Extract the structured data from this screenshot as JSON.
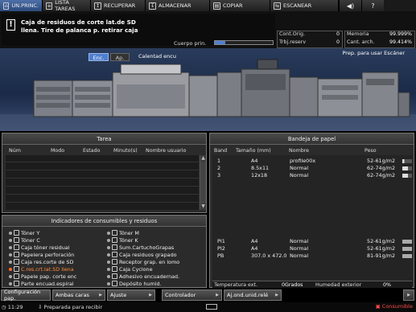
{
  "topbar": {
    "tabs": [
      {
        "label": "UN.PRINC.",
        "icon": "home-icon",
        "active": true
      },
      {
        "label": "LISTA TAREAS",
        "icon": "job-list-icon",
        "active": false
      },
      {
        "label": "RECUPERAR",
        "icon": "recall-icon",
        "active": false
      },
      {
        "label": "ALMACENAR",
        "icon": "store-icon",
        "active": false
      },
      {
        "label": "COPIAR",
        "icon": "copy-icon",
        "active": false
      },
      {
        "label": "ESCANEAR",
        "icon": "scan-icon",
        "active": false
      }
    ],
    "volume_icon": "speaker-icon",
    "help_icon": "?"
  },
  "message": {
    "icon": "!",
    "line1": "Caja de residuos de corte lat.de SD",
    "line2": "llena. Tire de palanca p. retirar caja"
  },
  "toner_bar": {
    "label": "Cuerpo prin.",
    "level": 0.18
  },
  "counters": {
    "orig_label": "Cont.Orig.",
    "orig_value": "0",
    "memory_label": "Memoria",
    "memory_value": "99.999%",
    "reserve_label": "Trbj.reserv",
    "reserve_value": "0",
    "arch_label": "Cant. arch.",
    "arch_value": "99.414%"
  },
  "machine": {
    "enc_label": "Enc.",
    "ap_label": "Ap.",
    "warm_label": "Calentad encu",
    "scan_label": "Prep. para usar Escáner"
  },
  "tasks": {
    "title": "Tarea",
    "columns": [
      "Núm",
      "Modo",
      "Estado",
      "Minuto(s)",
      "Nombre usuario"
    ]
  },
  "consumables": {
    "title": "Indicadores de consumibles y residuos",
    "items": [
      {
        "label": "Tóner Y",
        "warn": false
      },
      {
        "label": "Tóner M",
        "warn": false
      },
      {
        "label": "Tóner C",
        "warn": false
      },
      {
        "label": "Tóner K",
        "warn": false
      },
      {
        "label": "Caja tóner residual",
        "warn": false
      },
      {
        "label": "Sum.CartuchoGrapas",
        "warn": false
      },
      {
        "label": "Papelera perforación",
        "warn": false
      },
      {
        "label": "Caja residuos grapado",
        "warn": false
      },
      {
        "label": "Caja res.corte de SD",
        "warn": false
      },
      {
        "label": "Receptor grap. en lomo",
        "warn": false
      },
      {
        "label": "C.res.crt.lat.SD llena",
        "warn": true
      },
      {
        "label": "Caja Cyclone",
        "warn": false
      },
      {
        "label": "Papele pap. corte enc",
        "warn": false
      },
      {
        "label": "Adhesivo encuadernad.",
        "warn": false
      },
      {
        "label": "Parte encuad.espiral",
        "warn": false
      },
      {
        "label": "Depósito humid.",
        "warn": false
      }
    ]
  },
  "trays": {
    "title": "Bandeja de papel",
    "columns": [
      "Band",
      "Tamaño (mm)",
      "Nombre",
      "Peso"
    ],
    "rows": [
      {
        "band": "1",
        "size": "A4",
        "name": "profile00x",
        "weight": "52-61g/m2",
        "level": 0.2
      },
      {
        "band": "2",
        "size": "8.5x11",
        "name": "Normal",
        "weight": "62-74g/m2",
        "level": 0.6
      },
      {
        "band": "3",
        "size": "12x18",
        "name": "Normal",
        "weight": "62-74g/m2",
        "level": 0.6
      }
    ],
    "bottom_rows": [
      {
        "band": "PI1",
        "size": "A4",
        "name": "Normal",
        "weight": "52-61g/m2"
      },
      {
        "band": "PI2",
        "size": "A4",
        "name": "Normal",
        "weight": "52-61g/m2"
      },
      {
        "band": "PB",
        "size": "307.0 x 472.0",
        "name": "Normal",
        "weight": "81-91g/m2"
      }
    ],
    "temp_label": "Temperatura ext.",
    "temp_value": "0Grados",
    "humidity_label": "Humedad exterior",
    "humidity_value": "0%"
  },
  "footer": {
    "buttons": [
      "Configuración pap.",
      "Ambas caras",
      "Ajuste",
      "Controlador",
      "Aj.ond.unid.relé"
    ],
    "time": "11:29",
    "status": "Preparada para recibir",
    "consumable": "Consumible"
  }
}
